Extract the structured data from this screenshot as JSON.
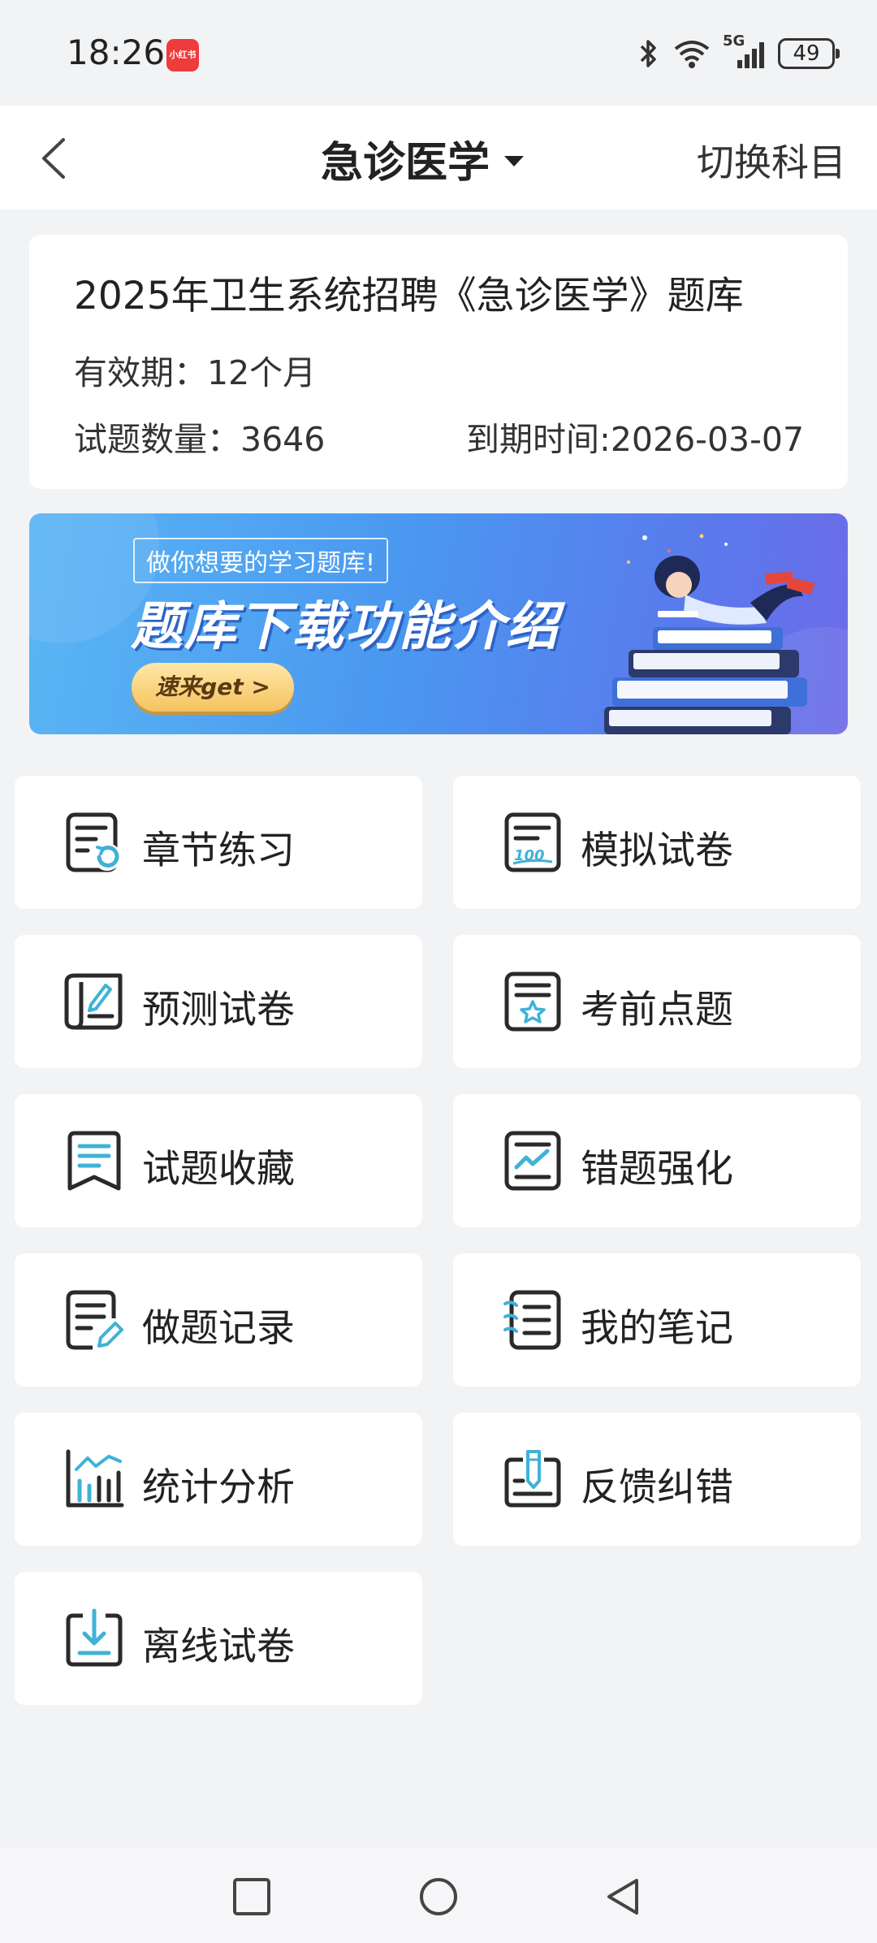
{
  "status_bar": {
    "time": "18:26",
    "app_badge": "小红书",
    "network": "5G",
    "battery": "49"
  },
  "nav": {
    "title": "急诊医学",
    "switch_label": "切换科目"
  },
  "info": {
    "title": "2025年卫生系统招聘《急诊医学》题库",
    "validity": "有效期：12个月",
    "count": "试题数量：3646",
    "expire": "到期时间:2026-03-07"
  },
  "banner": {
    "tag": "做你想要的学习题库!",
    "title": "题库下载功能介绍",
    "button": "速来get >"
  },
  "menu": {
    "items": [
      {
        "label": "章节练习",
        "icon": "chapter-practice-icon"
      },
      {
        "label": "模拟试卷",
        "icon": "mock-exam-icon"
      },
      {
        "label": "预测试卷",
        "icon": "prediction-exam-icon"
      },
      {
        "label": "考前点题",
        "icon": "key-points-icon"
      },
      {
        "label": "试题收藏",
        "icon": "bookmark-icon"
      },
      {
        "label": "错题强化",
        "icon": "wrong-questions-icon"
      },
      {
        "label": "做题记录",
        "icon": "record-icon"
      },
      {
        "label": "我的笔记",
        "icon": "notes-icon"
      },
      {
        "label": "统计分析",
        "icon": "statistics-icon"
      },
      {
        "label": "反馈纠错",
        "icon": "feedback-icon"
      },
      {
        "label": "离线试卷",
        "icon": "offline-download-icon"
      }
    ]
  },
  "colors": {
    "accent": "#3fb2d6",
    "icon_stroke": "#2a2a2a",
    "background": "#f2f3f5"
  }
}
